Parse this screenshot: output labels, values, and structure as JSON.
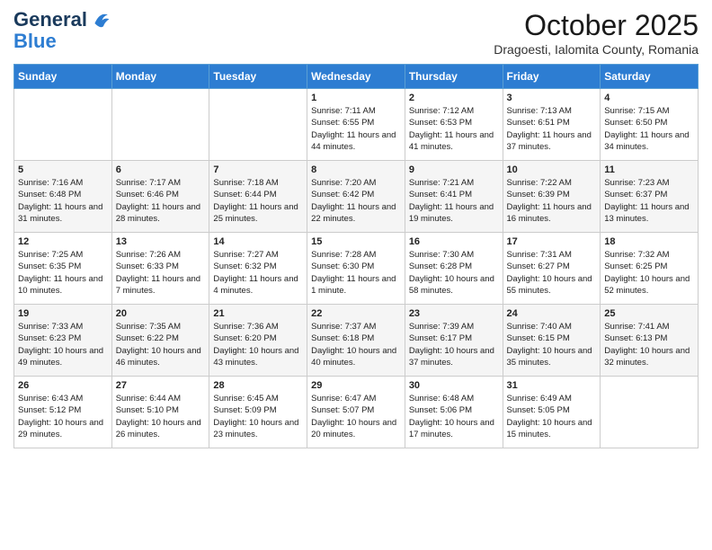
{
  "header": {
    "logo_line1": "General",
    "logo_line2": "Blue",
    "month": "October 2025",
    "location": "Dragoesti, Ialomita County, Romania"
  },
  "weekdays": [
    "Sunday",
    "Monday",
    "Tuesday",
    "Wednesday",
    "Thursday",
    "Friday",
    "Saturday"
  ],
  "weeks": [
    [
      {
        "day": "",
        "content": ""
      },
      {
        "day": "",
        "content": ""
      },
      {
        "day": "",
        "content": ""
      },
      {
        "day": "1",
        "content": "Sunrise: 7:11 AM\nSunset: 6:55 PM\nDaylight: 11 hours and 44 minutes."
      },
      {
        "day": "2",
        "content": "Sunrise: 7:12 AM\nSunset: 6:53 PM\nDaylight: 11 hours and 41 minutes."
      },
      {
        "day": "3",
        "content": "Sunrise: 7:13 AM\nSunset: 6:51 PM\nDaylight: 11 hours and 37 minutes."
      },
      {
        "day": "4",
        "content": "Sunrise: 7:15 AM\nSunset: 6:50 PM\nDaylight: 11 hours and 34 minutes."
      }
    ],
    [
      {
        "day": "5",
        "content": "Sunrise: 7:16 AM\nSunset: 6:48 PM\nDaylight: 11 hours and 31 minutes."
      },
      {
        "day": "6",
        "content": "Sunrise: 7:17 AM\nSunset: 6:46 PM\nDaylight: 11 hours and 28 minutes."
      },
      {
        "day": "7",
        "content": "Sunrise: 7:18 AM\nSunset: 6:44 PM\nDaylight: 11 hours and 25 minutes."
      },
      {
        "day": "8",
        "content": "Sunrise: 7:20 AM\nSunset: 6:42 PM\nDaylight: 11 hours and 22 minutes."
      },
      {
        "day": "9",
        "content": "Sunrise: 7:21 AM\nSunset: 6:41 PM\nDaylight: 11 hours and 19 minutes."
      },
      {
        "day": "10",
        "content": "Sunrise: 7:22 AM\nSunset: 6:39 PM\nDaylight: 11 hours and 16 minutes."
      },
      {
        "day": "11",
        "content": "Sunrise: 7:23 AM\nSunset: 6:37 PM\nDaylight: 11 hours and 13 minutes."
      }
    ],
    [
      {
        "day": "12",
        "content": "Sunrise: 7:25 AM\nSunset: 6:35 PM\nDaylight: 11 hours and 10 minutes."
      },
      {
        "day": "13",
        "content": "Sunrise: 7:26 AM\nSunset: 6:33 PM\nDaylight: 11 hours and 7 minutes."
      },
      {
        "day": "14",
        "content": "Sunrise: 7:27 AM\nSunset: 6:32 PM\nDaylight: 11 hours and 4 minutes."
      },
      {
        "day": "15",
        "content": "Sunrise: 7:28 AM\nSunset: 6:30 PM\nDaylight: 11 hours and 1 minute."
      },
      {
        "day": "16",
        "content": "Sunrise: 7:30 AM\nSunset: 6:28 PM\nDaylight: 10 hours and 58 minutes."
      },
      {
        "day": "17",
        "content": "Sunrise: 7:31 AM\nSunset: 6:27 PM\nDaylight: 10 hours and 55 minutes."
      },
      {
        "day": "18",
        "content": "Sunrise: 7:32 AM\nSunset: 6:25 PM\nDaylight: 10 hours and 52 minutes."
      }
    ],
    [
      {
        "day": "19",
        "content": "Sunrise: 7:33 AM\nSunset: 6:23 PM\nDaylight: 10 hours and 49 minutes."
      },
      {
        "day": "20",
        "content": "Sunrise: 7:35 AM\nSunset: 6:22 PM\nDaylight: 10 hours and 46 minutes."
      },
      {
        "day": "21",
        "content": "Sunrise: 7:36 AM\nSunset: 6:20 PM\nDaylight: 10 hours and 43 minutes."
      },
      {
        "day": "22",
        "content": "Sunrise: 7:37 AM\nSunset: 6:18 PM\nDaylight: 10 hours and 40 minutes."
      },
      {
        "day": "23",
        "content": "Sunrise: 7:39 AM\nSunset: 6:17 PM\nDaylight: 10 hours and 37 minutes."
      },
      {
        "day": "24",
        "content": "Sunrise: 7:40 AM\nSunset: 6:15 PM\nDaylight: 10 hours and 35 minutes."
      },
      {
        "day": "25",
        "content": "Sunrise: 7:41 AM\nSunset: 6:13 PM\nDaylight: 10 hours and 32 minutes."
      }
    ],
    [
      {
        "day": "26",
        "content": "Sunrise: 6:43 AM\nSunset: 5:12 PM\nDaylight: 10 hours and 29 minutes."
      },
      {
        "day": "27",
        "content": "Sunrise: 6:44 AM\nSunset: 5:10 PM\nDaylight: 10 hours and 26 minutes."
      },
      {
        "day": "28",
        "content": "Sunrise: 6:45 AM\nSunset: 5:09 PM\nDaylight: 10 hours and 23 minutes."
      },
      {
        "day": "29",
        "content": "Sunrise: 6:47 AM\nSunset: 5:07 PM\nDaylight: 10 hours and 20 minutes."
      },
      {
        "day": "30",
        "content": "Sunrise: 6:48 AM\nSunset: 5:06 PM\nDaylight: 10 hours and 17 minutes."
      },
      {
        "day": "31",
        "content": "Sunrise: 6:49 AM\nSunset: 5:05 PM\nDaylight: 10 hours and 15 minutes."
      },
      {
        "day": "",
        "content": ""
      }
    ]
  ]
}
